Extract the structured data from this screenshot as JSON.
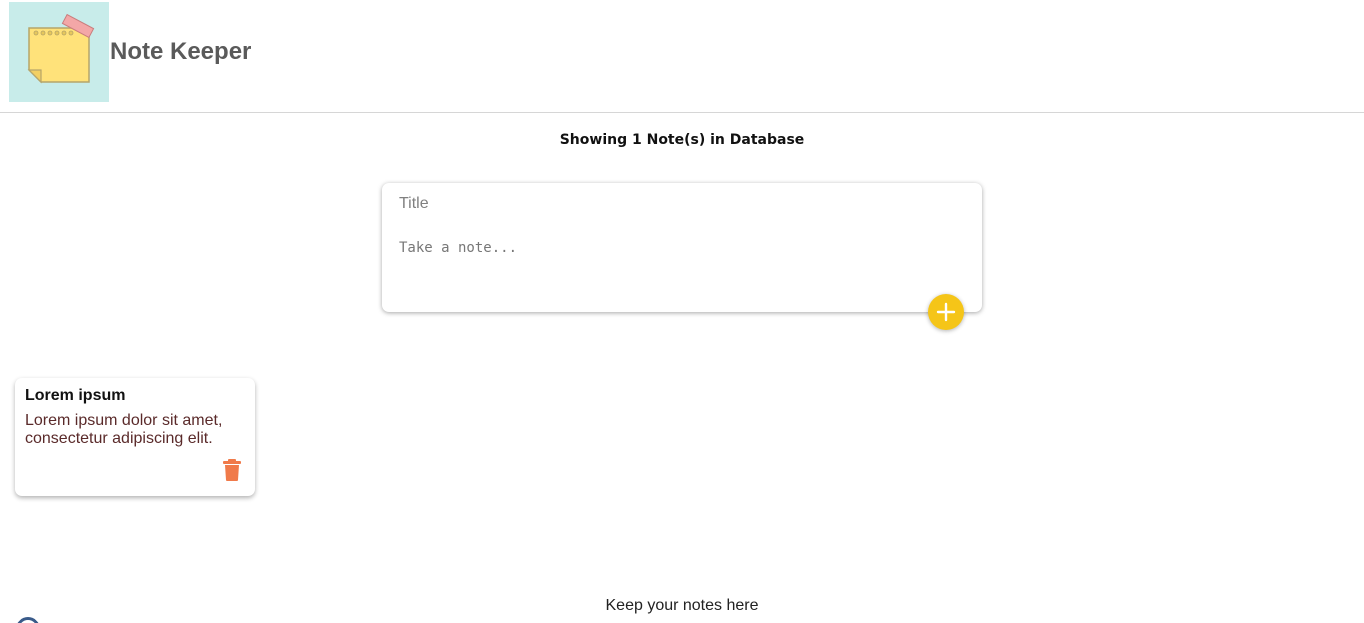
{
  "header": {
    "app_title": "Note Keeper",
    "logo_icon": "sticky-note-icon"
  },
  "status": {
    "count_text": "Showing 1 Note(s) in Database"
  },
  "create_form": {
    "title_placeholder": "Title",
    "content_placeholder": "Take a note...",
    "add_icon": "plus-icon"
  },
  "notes": [
    {
      "title": "Lorem ipsum",
      "content": "Lorem ipsum dolor sit amet, consectetur adipiscing elit.",
      "delete_icon": "trash-icon"
    }
  ],
  "footer": {
    "text": "Keep your notes here"
  },
  "colors": {
    "accent": "#f5c518",
    "delete": "#f07a4a",
    "logo_bg": "#c8ecea",
    "note_body": "#5a2a2a"
  }
}
